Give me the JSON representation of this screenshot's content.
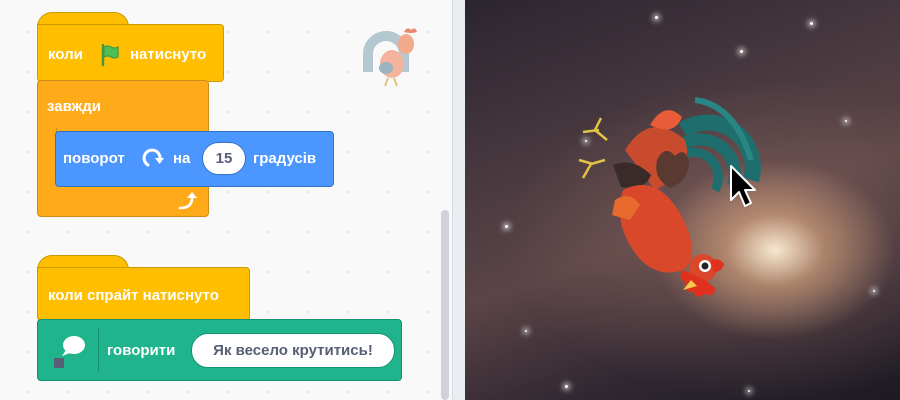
{
  "script1": {
    "hat_prefix": "коли",
    "hat_suffix": "натиснуто",
    "forever_label": "завжди",
    "turn_label": "поворот",
    "turn_on": "на",
    "turn_value": "15",
    "turn_units": "градусів"
  },
  "script2": {
    "hat_label": "коли спрайт натиснуто",
    "say_label": "говорити",
    "say_value": "Як весело крутитись!"
  },
  "colors": {
    "events": "#ffbf00",
    "control": "#ffab19",
    "motion": "#4c97ff",
    "looks": "#1fb48c",
    "flag": "#4cbf56"
  },
  "icons": {
    "flag": "green-flag-icon",
    "turn": "turn-right-icon",
    "loop": "loop-arrow-icon",
    "speech": "speech-bubble-icon",
    "sprite": "rooster-sprite",
    "cursor": "mouse-cursor-icon"
  }
}
